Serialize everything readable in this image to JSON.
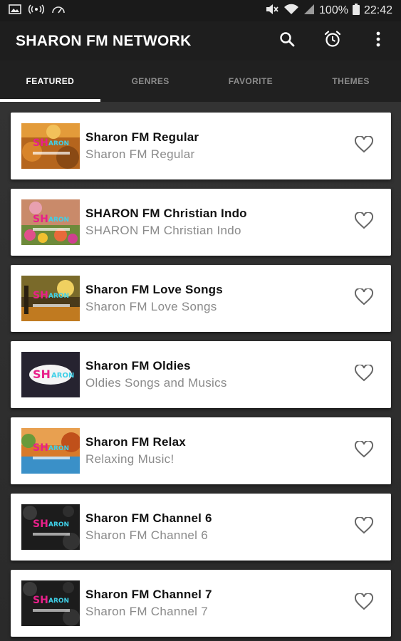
{
  "status_bar": {
    "battery": "100%",
    "time": "22:42"
  },
  "app_bar": {
    "title": "SHARON FM NETWORK"
  },
  "tabs": [
    {
      "label": "FEATURED",
      "active": true
    },
    {
      "label": "GENRES",
      "active": false
    },
    {
      "label": "FAVORITE",
      "active": false
    },
    {
      "label": "THEMES",
      "active": false
    }
  ],
  "stations": [
    {
      "title": "Sharon FM Regular",
      "subtitle": "Sharon FM Regular",
      "theme": "autumn"
    },
    {
      "title": "SHARON FM Christian Indo",
      "subtitle": "SHARON FM Christian Indo",
      "theme": "flowers"
    },
    {
      "title": "Sharon FM Love Songs",
      "subtitle": "Sharon FM Love Songs",
      "theme": "sunset"
    },
    {
      "title": "Sharon FM Oldies",
      "subtitle": "Oldies Songs and Musics",
      "theme": "dark"
    },
    {
      "title": "Sharon FM Relax",
      "subtitle": "Relaxing Music!",
      "theme": "lake"
    },
    {
      "title": "Sharon FM Channel 6",
      "subtitle": "Sharon FM Channel 6",
      "theme": "night"
    },
    {
      "title": "Sharon FM Channel 7",
      "subtitle": "Sharon FM Channel 7",
      "theme": "night"
    }
  ],
  "logo_text": "SHARON",
  "colors": {
    "logo_pink": "#e8208a",
    "logo_cyan": "#3fd0e8",
    "heart": "#666666"
  }
}
